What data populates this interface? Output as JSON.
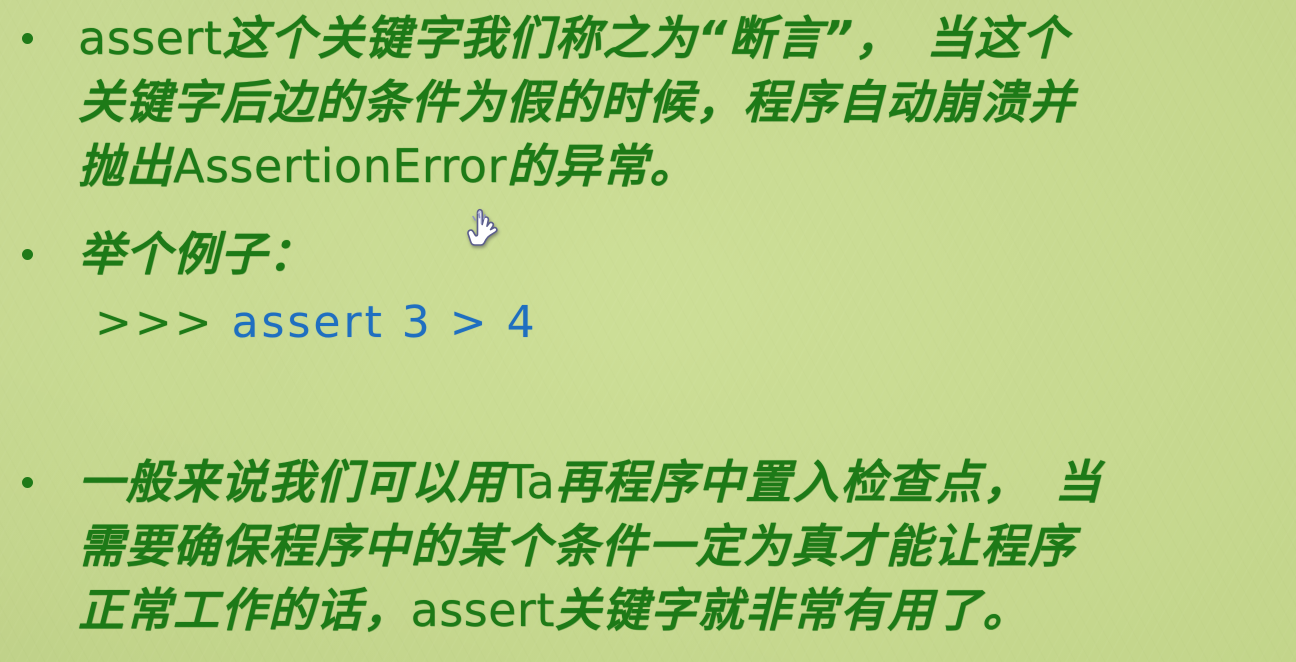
{
  "slide": {
    "background_color": "#c9dc8f",
    "text_color": "#1d7a17",
    "code_color": "#1f6fc0",
    "bullet_color": "#1f7a18"
  },
  "bullets": [
    {
      "marker": "•",
      "lines": [
        {
          "segments": [
            {
              "text": "assert",
              "script": "latin"
            },
            {
              "text": "这个关键字我们称之为“断言”，　当这个",
              "script": "cjk"
            }
          ]
        },
        {
          "segments": [
            {
              "text": "关键字后边的条件为假的时候，程序自动崩溃并",
              "script": "cjk"
            }
          ]
        },
        {
          "segments": [
            {
              "text": "抛出",
              "script": "cjk"
            },
            {
              "text": "AssertionError",
              "script": "latin"
            },
            {
              "text": "的异常。",
              "script": "cjk"
            }
          ]
        }
      ]
    },
    {
      "marker": "•",
      "lines": [
        {
          "segments": [
            {
              "text": "举个例子：",
              "script": "cjk"
            }
          ]
        }
      ]
    },
    {
      "marker": "•",
      "lines": [
        {
          "segments": [
            {
              "text": "一般来说我们可以用",
              "script": "cjk"
            },
            {
              "text": "Ta",
              "script": "latin"
            },
            {
              "text": "再程序中置入检查点，　当",
              "script": "cjk"
            }
          ]
        },
        {
          "segments": [
            {
              "text": "需要确保程序中的某个条件一定为真才能让程序",
              "script": "cjk"
            }
          ]
        },
        {
          "segments": [
            {
              "text": "正常工作的话，",
              "script": "cjk"
            },
            {
              "text": "assert",
              "script": "latin"
            },
            {
              "text": "关键字就非常有用了。",
              "script": "cjk"
            }
          ]
        }
      ]
    }
  ],
  "code_example": {
    "prompt": ">>> ",
    "statement": "assert 3 > 4"
  },
  "cursor": {
    "icon": "pointing-hand-cursor"
  }
}
